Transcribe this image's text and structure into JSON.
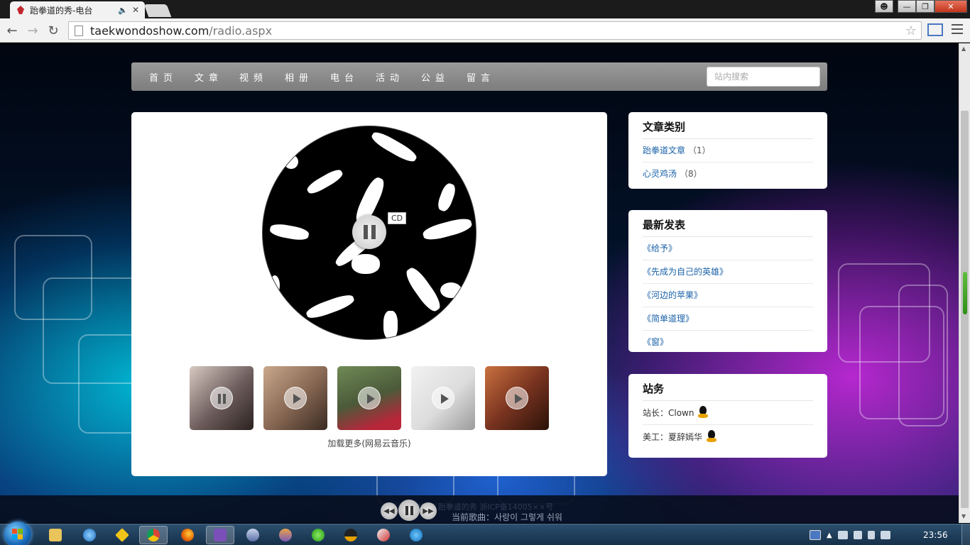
{
  "browser": {
    "tab_title": "跆拳道的秀-电台",
    "url_host": "taekwondoshow.com",
    "url_path": "/radio.aspx"
  },
  "nav": {
    "items": [
      "首页",
      "文章",
      "视频",
      "相册",
      "电台",
      "活动",
      "公益",
      "留言"
    ],
    "search_placeholder": "站内搜索"
  },
  "player": {
    "cd_tooltip": "CD",
    "load_more": "加载更多(网易云音乐)",
    "thumbnails": [
      {
        "color": "#6b5b5a",
        "state": "paused"
      },
      {
        "color": "#8a6a55",
        "state": "play"
      },
      {
        "color": "#4b5a3a",
        "state": "play"
      },
      {
        "color": "#dcdcdc",
        "state": "play"
      },
      {
        "color": "#7a3420",
        "state": "play"
      }
    ],
    "footer": "© 2015 跆拳道的秀 浙ICP备14005××号",
    "now_playing_label": "当前歌曲：",
    "now_playing_song": "사랑이 그렇게 쉬워"
  },
  "sidebar": {
    "categories": {
      "title": "文章类别",
      "items": [
        {
          "label": "跆拳道文章",
          "count": "（1）"
        },
        {
          "label": "心灵鸡汤",
          "count": "（8）"
        }
      ]
    },
    "latest": {
      "title": "最新发表",
      "items": [
        "《给予》",
        "《先成为自己的英雄》",
        "《河边的苹果》",
        "《简单道理》",
        "《窗》"
      ]
    },
    "staff": {
      "title": "站务",
      "rows": [
        {
          "label": "站长：Clown"
        },
        {
          "label": "美工：夏辞嫣华"
        }
      ]
    }
  },
  "taskbar": {
    "clock": "23:56"
  },
  "colors": {
    "link": "#1a62a8",
    "navbar": "#8a8a8a"
  }
}
